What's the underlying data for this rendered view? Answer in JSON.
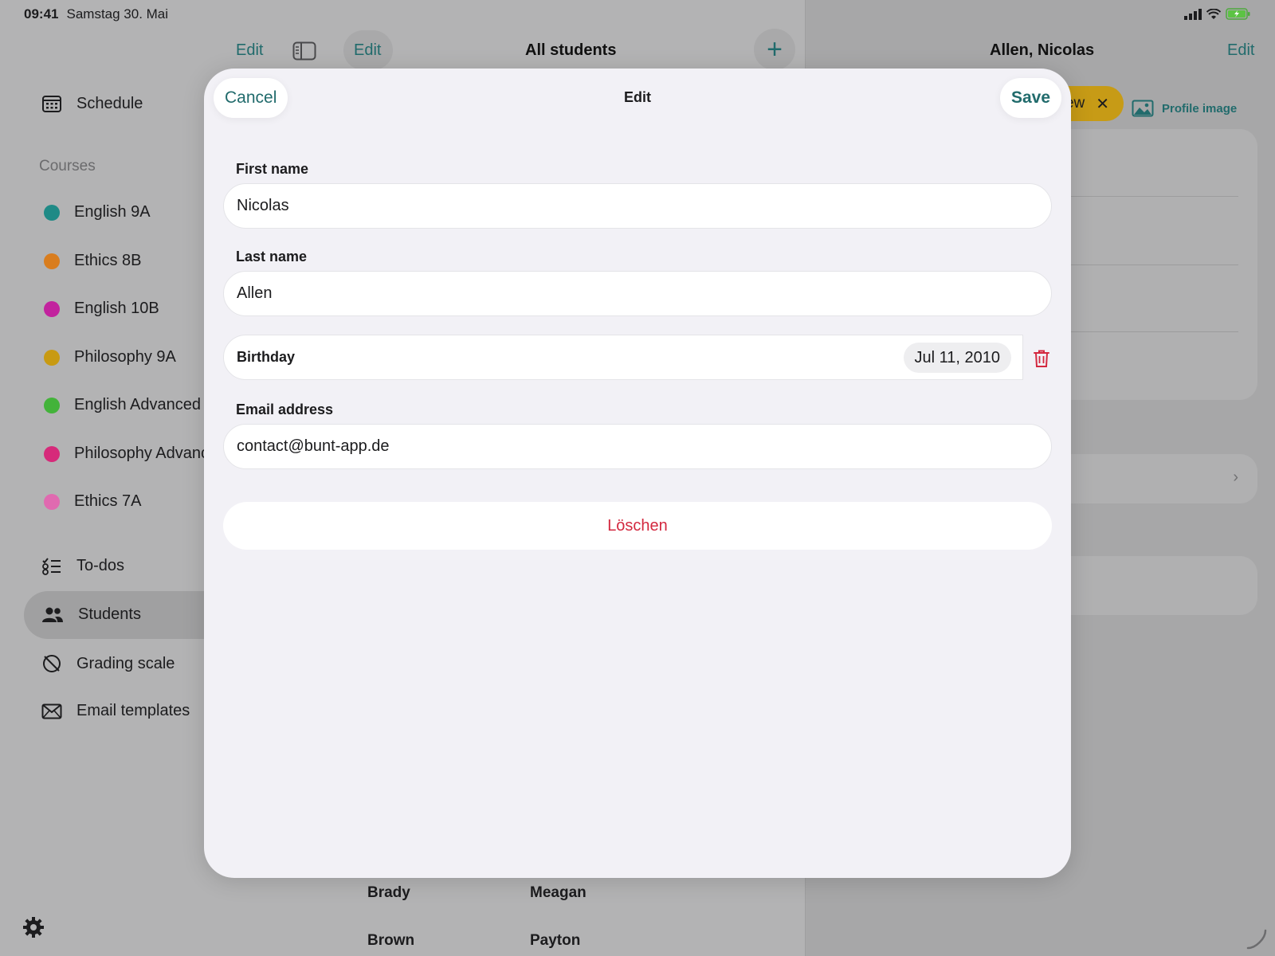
{
  "status": {
    "time": "09:41",
    "date": "Samstag 30. Mai"
  },
  "toolbar": {
    "sidebar_edit": "Edit",
    "list_edit": "Edit",
    "list_title": "All students",
    "detail_title": "Allen, Nicolas",
    "detail_edit": "Edit"
  },
  "sidebar": {
    "schedule": "Schedule",
    "courses_header": "Courses",
    "courses": [
      {
        "label": "English 9A",
        "color": "#1f8a86"
      },
      {
        "label": "Ethics 8B",
        "color": "#d97d1e"
      },
      {
        "label": "English 10B",
        "color": "#c2239e"
      },
      {
        "label": "Philosophy 9A",
        "color": "#c89a12"
      },
      {
        "label": "English Advanced",
        "color": "#43b33a"
      },
      {
        "label": "Philosophy Advanced",
        "color": "#d62a7a"
      },
      {
        "label": "Ethics 7A",
        "color": "#e06ab0"
      }
    ],
    "todos": "To-dos",
    "students": "Students",
    "grading": "Grading scale",
    "email_templates": "Email templates"
  },
  "list_rows": [
    {
      "last": "Brady",
      "first": "Meagan"
    },
    {
      "last": "Brown",
      "first": "Payton"
    }
  ],
  "detail": {
    "chip_text": "ew",
    "profile_image": "Profile image"
  },
  "modal": {
    "cancel": "Cancel",
    "title": "Edit",
    "save": "Save",
    "first_name_label": "First name",
    "first_name_value": "Nicolas",
    "last_name_label": "Last name",
    "last_name_value": "Allen",
    "birthday_label": "Birthday",
    "birthday_value": "Jul 11, 2010",
    "email_label": "Email address",
    "email_value": "contact@bunt-app.de",
    "delete": "Löschen"
  }
}
